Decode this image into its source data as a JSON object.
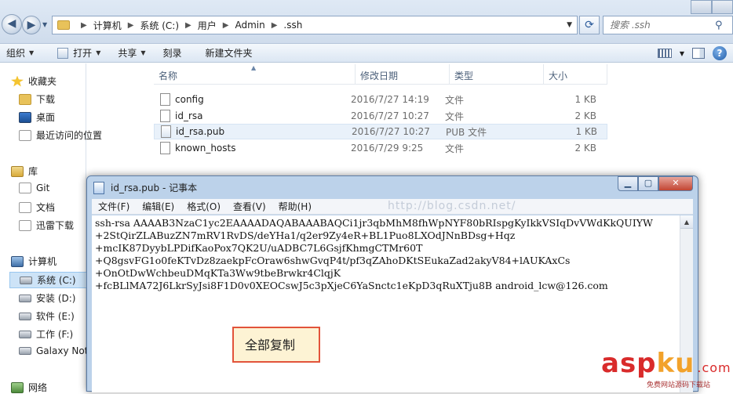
{
  "address": {
    "breadcrumbs": [
      "计算机",
      "系统 (C:)",
      "用户",
      "Admin",
      ".ssh"
    ]
  },
  "search": {
    "placeholder": "搜索 .ssh"
  },
  "toolbar": {
    "organize": "组织",
    "open": "打开",
    "share": "共享",
    "burn": "刻录",
    "new_folder": "新建文件夹"
  },
  "nav": {
    "favorites": "收藏夹",
    "downloads": "下载",
    "desktop": "桌面",
    "recent": "最近访问的位置",
    "libraries": "库",
    "git": "Git",
    "documents": "文档",
    "xunlei": "迅雷下载",
    "computer": "计算机",
    "drive_c": "系统 (C:)",
    "drive_d": "安装 (D:)",
    "drive_e": "软件 (E:)",
    "drive_f": "工作 (F:)",
    "galaxy": "Galaxy Not",
    "network": "网络"
  },
  "columns": {
    "name": "名称",
    "date": "修改日期",
    "type": "类型",
    "size": "大小"
  },
  "files": [
    {
      "name": "config",
      "date": "2016/7/27 14:19",
      "type": "文件",
      "size": "1 KB"
    },
    {
      "name": "id_rsa",
      "date": "2016/7/27 10:27",
      "type": "文件",
      "size": "2 KB"
    },
    {
      "name": "id_rsa.pub",
      "date": "2016/7/27 10:27",
      "type": "PUB 文件",
      "size": "1 KB"
    },
    {
      "name": "known_hosts",
      "date": "2016/7/29 9:25",
      "type": "文件",
      "size": "2 KB"
    }
  ],
  "notepad": {
    "title": "id_rsa.pub - 记事本",
    "menu": [
      "文件(F)",
      "编辑(E)",
      "格式(O)",
      "查看(V)",
      "帮助(H)"
    ],
    "watermark": "http://blog.csdn.net/",
    "content": "ssh-rsa AAAAB3NzaC1yc2EAAAADAQABAAABAQCi1jr3qbMhM8fhWpNYF80bRIspgKyIkkVSIqDvVWdKkQUIYW\n+2StQirZLABuzZN7mRV1RvDS/deYHa1/q2er9Zy4eR+BL1Puo8LXOdJNnBDsg+Hqz\n+mcIK87DyybLPDifKaoPox7QK2U/uADBC7L6GsjfKhmgCTMr60T\n+Q8gsvFG1o0feKTvDz8zaekpFcOraw6shwGvqP4t/pf3qZAhoDKtSEukaZad2akyV84+lAUKAxCs\n+OnOtDwWchbeuDMqKTa3Ww9tbeBrwkr4ClqjK\n+fcBLlMA72J6LkrSyJsi8F1D0v0XEOCswJ5c3pXjeC6YaSnctc1eKpD3qRuXTju8B android_lcw@126.com"
  },
  "callout": {
    "text": "全部复制"
  },
  "logo": {
    "part1": "asp",
    "part2": "ku",
    "suffix": ".com",
    "sub": "免费网站源码下载站"
  }
}
